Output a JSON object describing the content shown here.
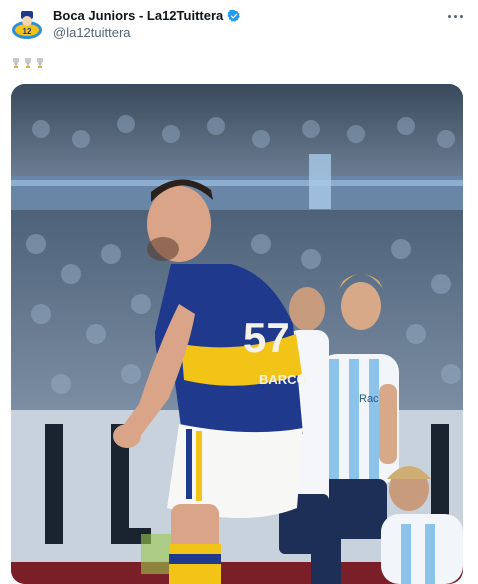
{
  "tweet": {
    "display_name": "Boca Juniors - La12Tuittera",
    "handle": "@la12tuittera",
    "verified": true,
    "text_emojis": [
      "trophy",
      "trophy",
      "trophy"
    ],
    "media": {
      "kind": "photo",
      "jersey_number": "57",
      "jersey_name": "BARCO",
      "opponent_sponsor": "Racing"
    }
  },
  "colors": {
    "boca_blue": "#1f3a8c",
    "boca_gold": "#f2c418",
    "racing_light_blue": "#8cc3ea",
    "verified_blue": "#1d9bf0",
    "muted_text": "#536471"
  },
  "icons": {
    "avatar": "team-crest-icon",
    "verified": "verified-badge-icon",
    "more": "more-options-icon"
  }
}
